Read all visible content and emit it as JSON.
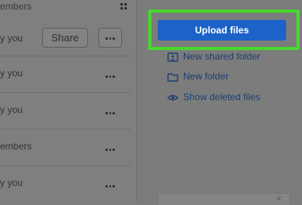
{
  "file_list": {
    "column_header": "embers",
    "rows": [
      {
        "owner": "y you",
        "share_label": "Share"
      },
      {
        "owner": "y you"
      },
      {
        "owner": "y you"
      },
      {
        "owner": "embers"
      },
      {
        "owner": "y you"
      }
    ]
  },
  "sidebar": {
    "upload_label": "Upload files",
    "actions": [
      {
        "label": "New shared folder",
        "icon": "shared-folder-icon"
      },
      {
        "label": "New folder",
        "icon": "folder-icon"
      },
      {
        "label": "Show deleted files",
        "icon": "eye-icon"
      }
    ]
  },
  "colors": {
    "primary_button": "#1c62c8",
    "highlight": "#46d82c",
    "link": "#1d3f72"
  }
}
